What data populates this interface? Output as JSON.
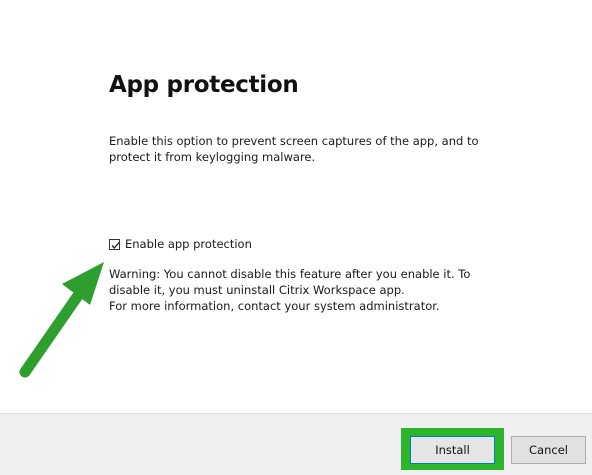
{
  "dialog": {
    "title": "App protection",
    "description_line1": "Enable this option to prevent screen captures of the app, and to",
    "description_line2": "protect it from keylogging malware.",
    "checkbox": {
      "label": "Enable app protection",
      "checked": true
    },
    "warning_line1": "Warning: You cannot disable this feature after you enable it. To",
    "warning_line2": "disable it, you must uninstall Citrix Workspace app.",
    "warning_line3": "For more information, contact your system administrator."
  },
  "footer": {
    "install_label": "Install",
    "cancel_label": "Cancel"
  },
  "colors": {
    "highlight": "#2bb62b",
    "arrow": "#2e9e2e"
  }
}
